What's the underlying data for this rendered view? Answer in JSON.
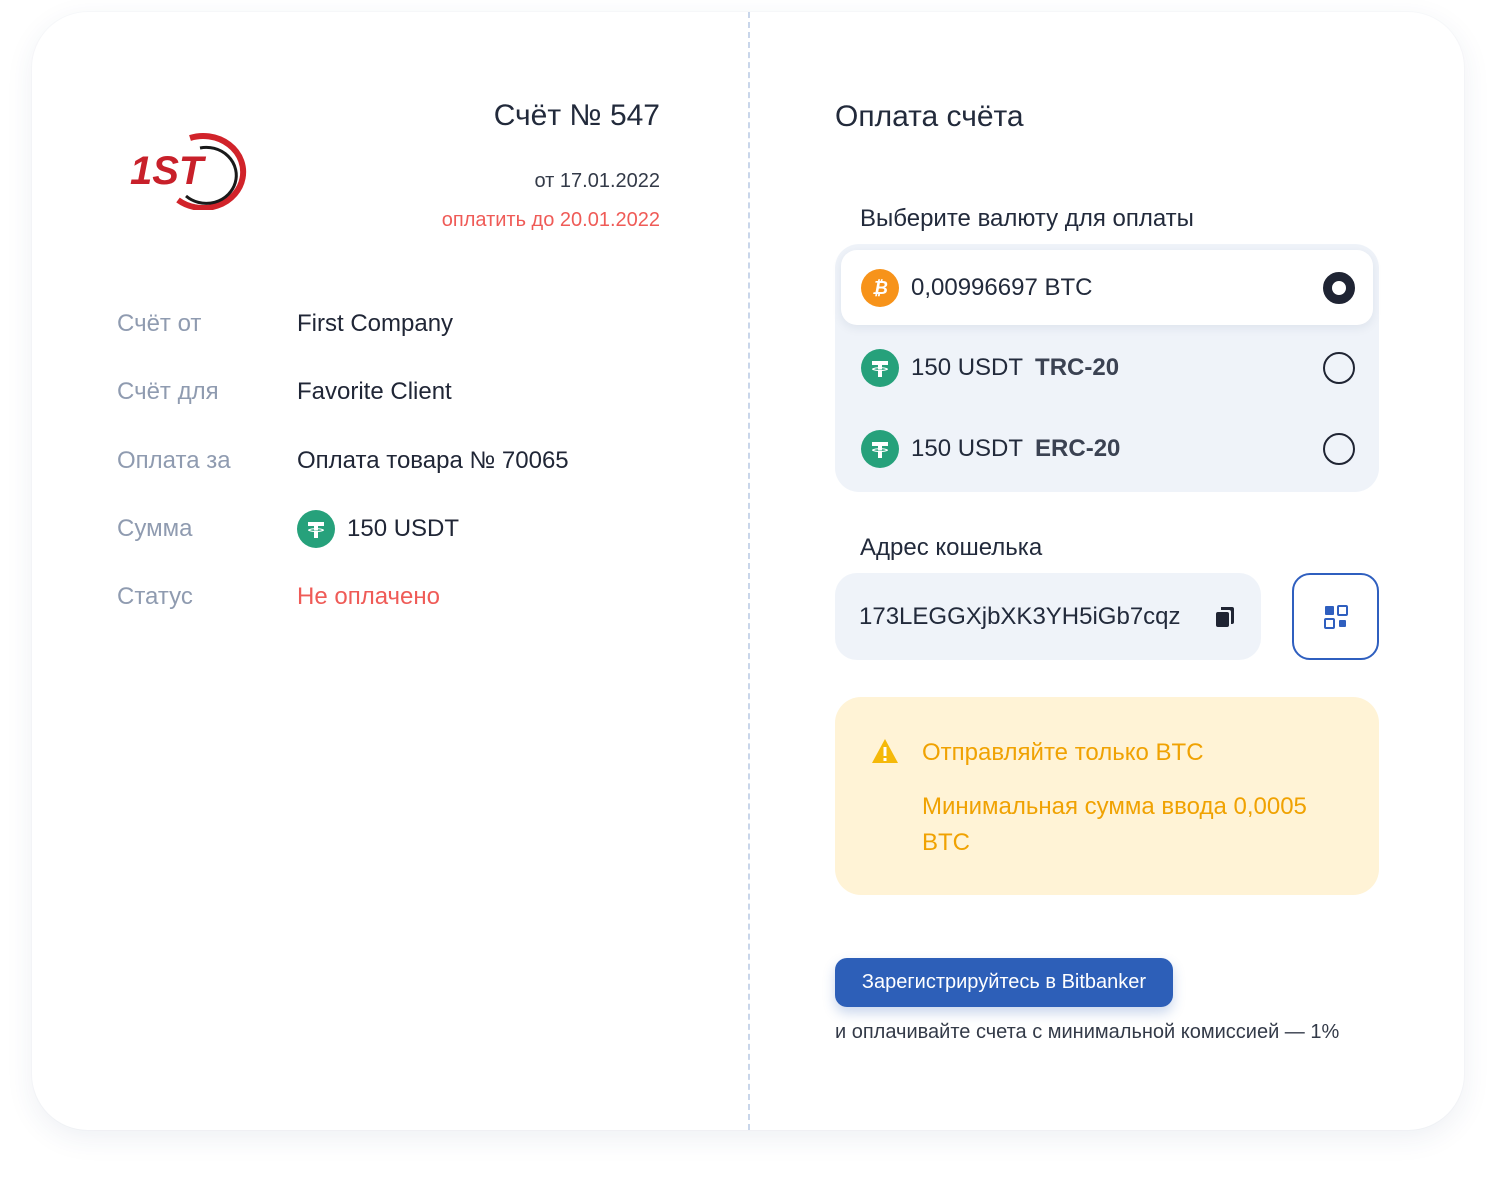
{
  "invoice": {
    "logo_text": "1ST",
    "title": "Счёт № 547",
    "date": "от 17.01.2022",
    "due": "оплатить до 20.01.2022",
    "details": [
      {
        "label": "Счёт от",
        "value": "First Company"
      },
      {
        "label": "Счёт для",
        "value": "Favorite Client"
      },
      {
        "label": "Оплата за",
        "value": "Оплата товара № 70065"
      },
      {
        "label": "Сумма",
        "value": "150 USDT"
      },
      {
        "label": "Статус",
        "value": "Не оплачено"
      }
    ]
  },
  "payment": {
    "title": "Оплата счёта",
    "currency_label": "Выберите валюту для оплаты",
    "currencies": [
      {
        "amount": "0,00996697 BTC",
        "network": "",
        "icon": "bitcoin-icon",
        "selected": true
      },
      {
        "amount": "150 USDT",
        "network": "TRC-20",
        "icon": "tether-icon",
        "selected": false
      },
      {
        "amount": "150 USDT",
        "network": "ERC-20",
        "icon": "tether-icon",
        "selected": false
      }
    ],
    "wallet_label": "Адрес кошелька",
    "wallet_address": "173LEGGXjbXK3YH5iGb7cqz",
    "warning": {
      "line1": "Отправляйте только BTC",
      "line2": "Минимальная сумма ввода 0,0005 BTC"
    },
    "register_button": "Зарегистрируйтесь в Bitbanker",
    "register_note": "и оплачивайте счета с минимальной комиссией — 1%"
  },
  "colors": {
    "accent": "#2d5fb8",
    "danger": "#ef5b57",
    "warning": "#f0a202",
    "bitcoin": "#f7931a",
    "tether": "#26a17b"
  }
}
